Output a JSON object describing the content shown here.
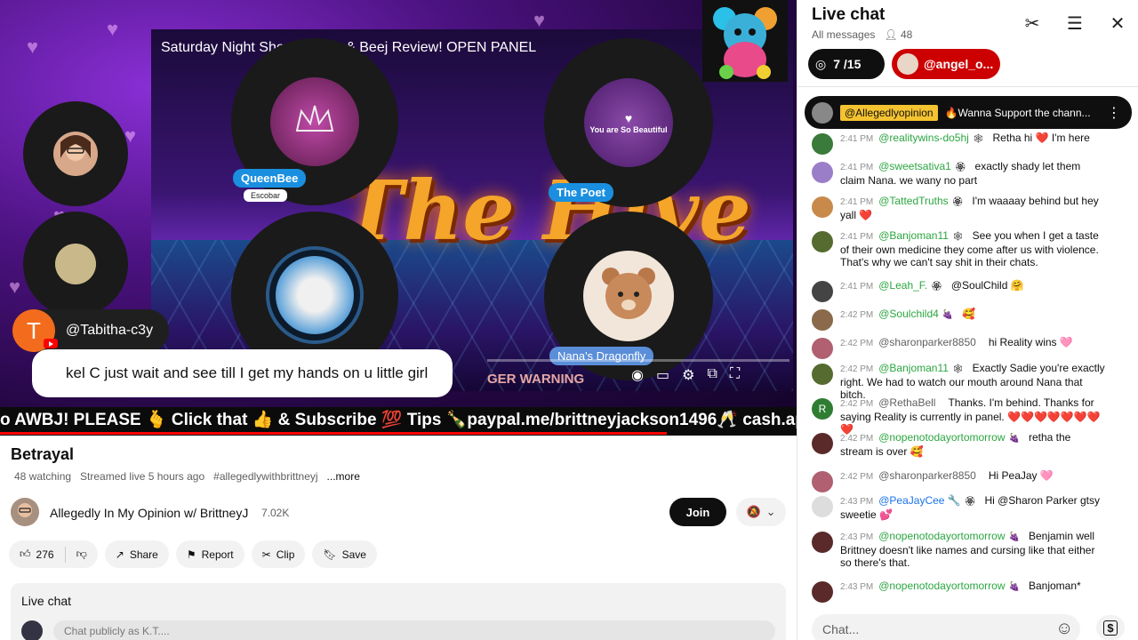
{
  "video": {
    "stage_title": "Saturday Night Shenanigans & Beej Review! OPEN PANEL",
    "panelists": [
      {
        "name": "QueenBee",
        "sub": "Escobar"
      },
      {
        "name": "The Poet",
        "sub": ""
      },
      {
        "name": "Nana's Dragonfly",
        "sub": ""
      }
    ],
    "poet_text": "You are So Beautiful",
    "warning_text": "GER WARNING",
    "ticker": "o AWBJ! PLEASE 🫰 Click that 👍 & Subscribe 💯 Tips 🍾paypal.me/brittneyjackson1496🥂 cash.app/$brit",
    "comment": {
      "avatar_letter": "T",
      "user": "@Tabitha-c3y",
      "text": "kel C just wait and see till I get my hands on u little girl"
    }
  },
  "info": {
    "title": "Betrayal",
    "watching": "48 watching",
    "streamed": "Streamed live 5 hours ago",
    "hashtag": "#allegedlywithbrittneyj",
    "more": "...more",
    "channel_name": "Allegedly In My Opinion w/ BrittneyJ",
    "subscribers": "7.02K",
    "join_label": "Join",
    "likes": "276",
    "share_label": "Share",
    "report_label": "Report",
    "clip_label": "Clip",
    "save_label": "Save",
    "live_chat_label": "Live chat",
    "chat_placeholder": "Chat publicly as K.T...."
  },
  "chat": {
    "title": "Live chat",
    "filter": "All messages",
    "viewers": "48",
    "goal": "7 /15",
    "donor": "@angel_o...",
    "pinned": {
      "tag": "@Allegedlyopinion",
      "text": "🔥Wanna Support the chann..."
    },
    "messages": [
      {
        "time": "2:41 PM",
        "author": "@realitywins-do5hj",
        "color": "green",
        "badge": "🕸",
        "text": "Retha hi ❤️ I'm here",
        "av": "#3a7a3a"
      },
      {
        "time": "2:41 PM",
        "author": "@sweetsativa1",
        "color": "green",
        "badge": "🏵",
        "text": "exactly shady let them claim Nana. we wany no part",
        "av": "#9b7ec8"
      },
      {
        "time": "2:41 PM",
        "author": "@TattedTruths",
        "color": "green",
        "badge": "🏵",
        "text": "I'm waaaay behind but hey yall ❤️",
        "av": "#c88a4a"
      },
      {
        "time": "2:41 PM",
        "author": "@Banjoman11",
        "color": "green",
        "badge": "🕸",
        "text": "See you when I get a taste of their own medicine they come after us with violence. That's why we can't say shit in their chats.",
        "av": "#556b2f"
      },
      {
        "time": "2:41 PM",
        "author": "@Leah_F.",
        "color": "green",
        "badge": "🏵",
        "text": "@SoulChild 🤗",
        "av": "#444"
      },
      {
        "time": "2:42 PM",
        "author": "@Soulchild4",
        "color": "green",
        "badge": "🍇",
        "text": "🥰",
        "av": "#8a6a4a"
      },
      {
        "time": "2:42 PM",
        "author": "@sharonparker8850",
        "color": "gray",
        "badge": "",
        "text": "hi Reality wins 🩷",
        "av": "#b06070"
      },
      {
        "time": "2:42 PM",
        "author": "@Banjoman11",
        "color": "green",
        "badge": "🕸",
        "text": "Exactly Sadie you're exactly right. We had to watch our mouth around Nana that bitch.",
        "av": "#556b2f"
      },
      {
        "time": "2:42 PM",
        "author": "@RethaBell",
        "color": "gray",
        "badge": "",
        "text": "Thanks. I'm behind. Thanks for saying Reality is currently in panel. ❤️❤️❤️❤️❤️❤️❤️❤️",
        "av": "#2e7d32",
        "letter": "R"
      },
      {
        "time": "2:42 PM",
        "author": "@nopenotodayortomorrow",
        "color": "green",
        "badge": "🍇",
        "text": "retha the stream is over 🥰",
        "av": "#5a2a2a"
      },
      {
        "time": "2:42 PM",
        "author": "@sharonparker8850",
        "color": "gray",
        "badge": "",
        "text": "Hi PeaJay 🩷",
        "av": "#b06070"
      },
      {
        "time": "2:43 PM",
        "author": "@PeaJayCee 🔧",
        "color": "blue",
        "badge": "🏵",
        "text": "Hi @Sharon Parker gtsy sweetie 💕",
        "av": "#ddd"
      },
      {
        "time": "2:43 PM",
        "author": "@nopenotodayortomorrow",
        "color": "green",
        "badge": "🍇",
        "text": "Benjamin well Brittney doesn't like names and cursing like that either so there's that.",
        "av": "#5a2a2a"
      },
      {
        "time": "2:43 PM",
        "author": "@nopenotodayortomorrow",
        "color": "green",
        "badge": "🍇",
        "text": "Banjoman*",
        "av": "#5a2a2a"
      }
    ],
    "input_placeholder": "Chat...",
    "dollar": "$"
  }
}
